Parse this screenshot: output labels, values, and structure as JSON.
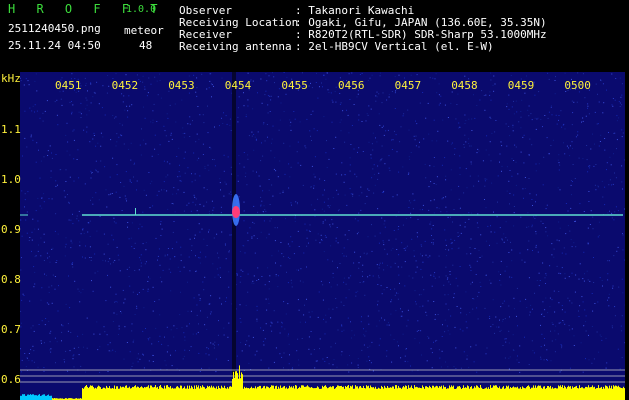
{
  "header": {
    "app_name": "H R O F F T",
    "version": "1.0.0",
    "filename": "2511240450.png",
    "detection_label": "meteor",
    "datetime": "25.11.24 04:50",
    "detection_count": "48",
    "info_labels": [
      "Observer",
      "Receiving Location",
      "Receiver",
      "Receiving antenna"
    ],
    "info_values": [
      ": Takanori Kawachi",
      ": Ogaki, Gifu, JAPAN (136.60E, 35.35N)",
      ": R820T2(RTL-SDR) SDR-Sharp 53.1000MHz",
      ": 2el-HB9CV Vertical (el. E-W)"
    ]
  },
  "spectrogram": {
    "y_unit": "kHz",
    "x_ticks": [
      "0451",
      "0452",
      "0453",
      "0454",
      "0455",
      "0456",
      "0457",
      "0458",
      "0459",
      "0500"
    ],
    "y_ticks": [
      "1.1",
      "1.0",
      "0.9",
      "0.8",
      "0.7",
      "0.6"
    ],
    "colors": {
      "background": "#0a0a6e",
      "trace": "#5fe0d0",
      "echo_core": "#ff3c78",
      "echo_halo": "#3c78ff",
      "level_bar": "#ffff00",
      "level_low": "#00c8ff",
      "axis_text": "#fff23c"
    }
  }
}
